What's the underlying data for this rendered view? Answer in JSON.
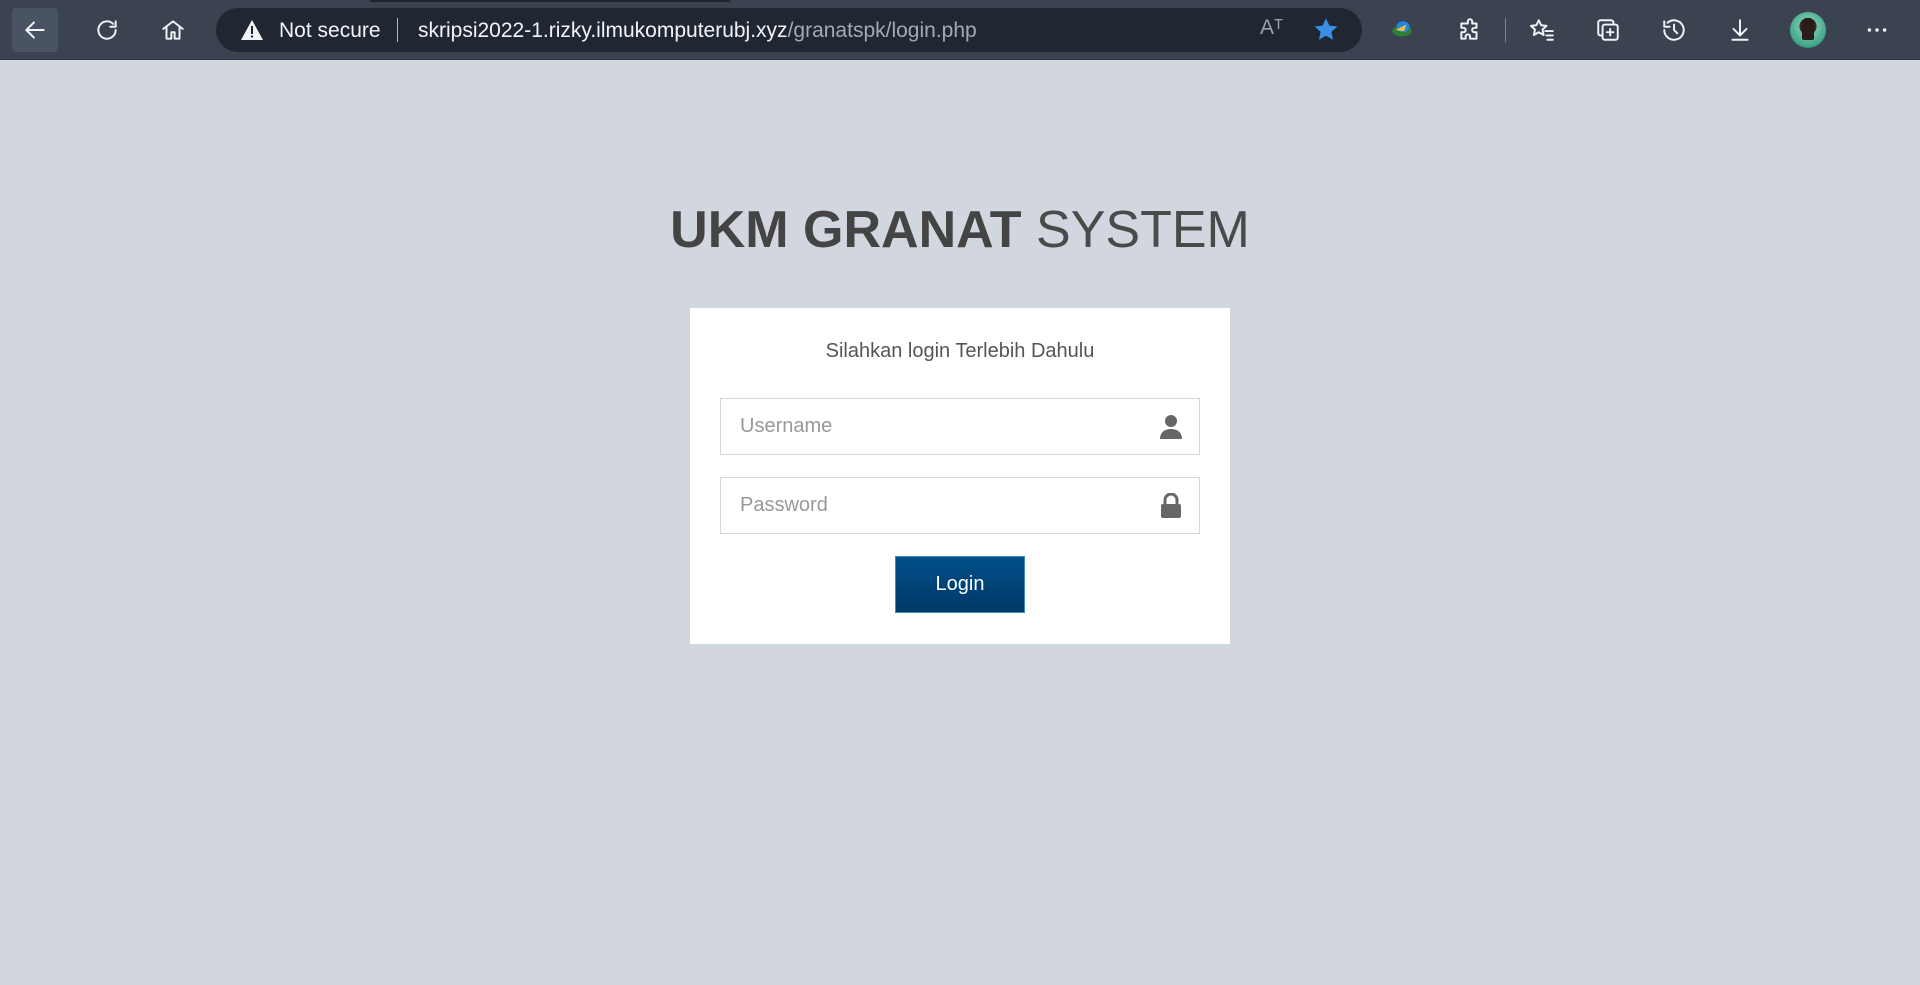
{
  "browser": {
    "security_label": "Not secure",
    "url_host": "skripsi2022-1.rizky.ilmukomputerubj.xyz",
    "url_path": "/granatspk/login.php",
    "read_aloud_glyph": "Aᵀ",
    "icons": {
      "back": "back-arrow-icon",
      "reload": "reload-icon",
      "home": "home-icon",
      "warning": "warning-icon",
      "read_aloud": "read-aloud-icon",
      "favorite": "star-icon",
      "extension_app": "idm-extension-icon",
      "extensions": "puzzle-icon",
      "favorites": "favorites-list-icon",
      "collections": "collections-icon",
      "history": "history-icon",
      "downloads": "download-icon",
      "profile": "avatar",
      "menu": "more-icon"
    },
    "colors": {
      "toolbar": "#3b4351",
      "addressbar": "#202733",
      "star_accent": "#3a8ee6"
    }
  },
  "page": {
    "title_strong": "UKM GRANAT",
    "title_light": " SYSTEM",
    "background": "#d2d6de"
  },
  "login": {
    "message": "Silahkan login Terlebih Dahulu",
    "username_placeholder": "Username",
    "password_placeholder": "Password",
    "username_value": "",
    "password_value": "",
    "submit_label": "Login",
    "icons": {
      "username": "user-icon",
      "password": "lock-icon"
    },
    "button_color": "#003d6e"
  }
}
